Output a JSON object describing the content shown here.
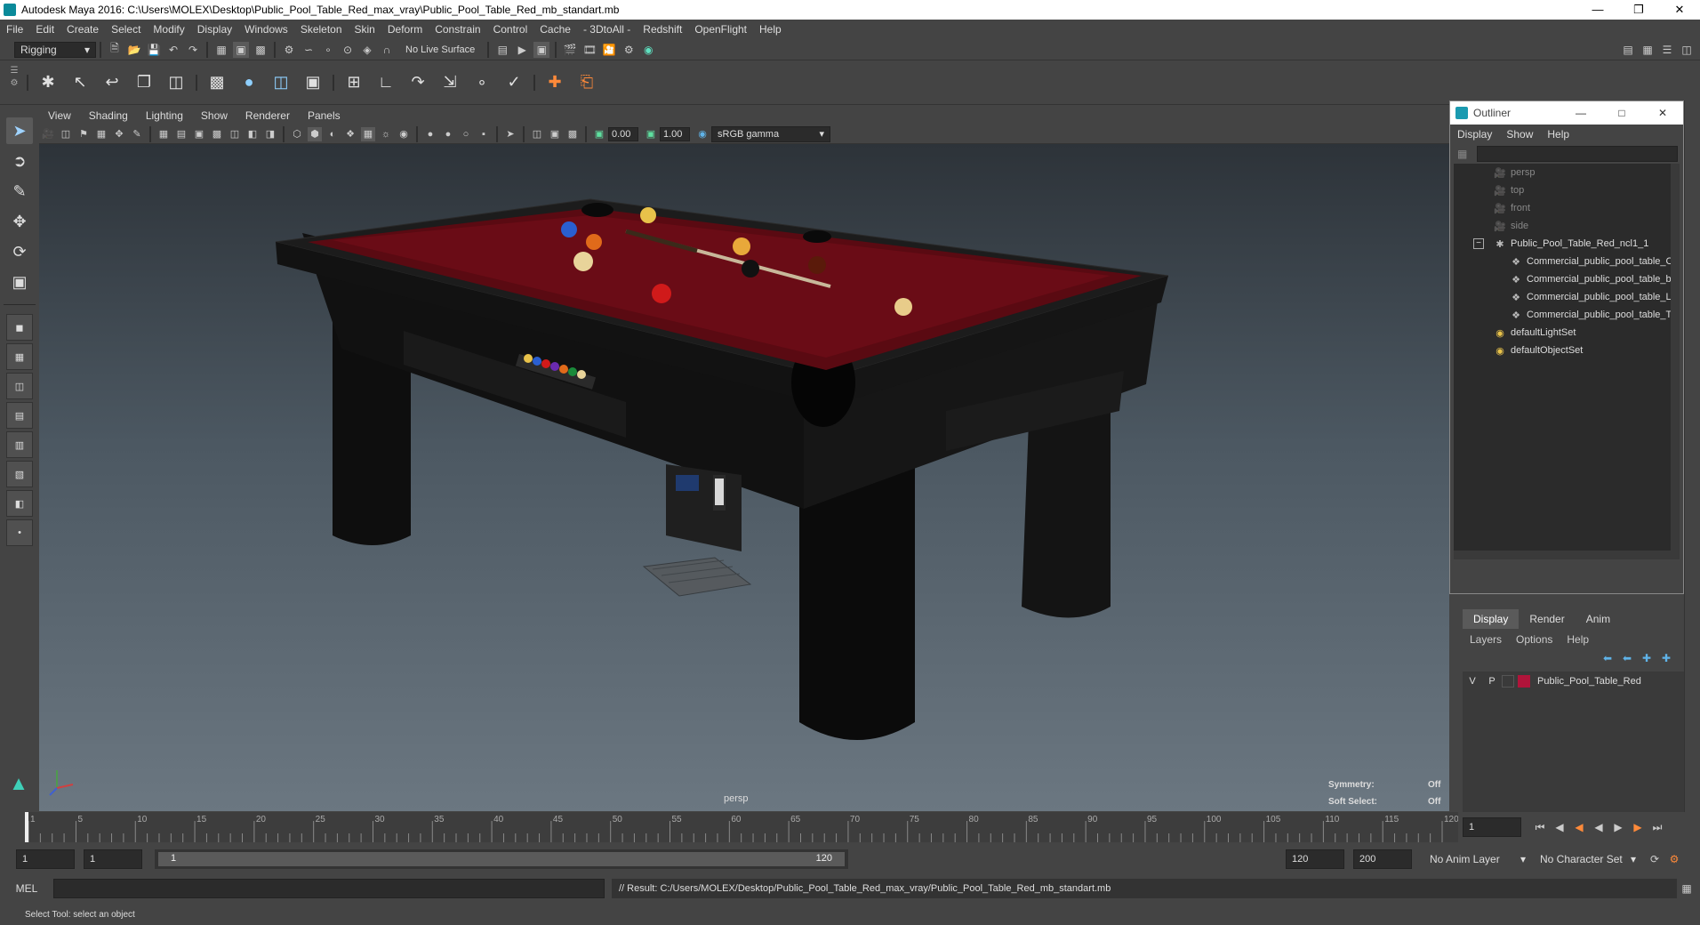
{
  "window": {
    "title": "Autodesk Maya 2016: C:\\Users\\MOLEX\\Desktop\\Public_Pool_Table_Red_max_vray\\Public_Pool_Table_Red_mb_standart.mb"
  },
  "menu": [
    "File",
    "Edit",
    "Create",
    "Select",
    "Modify",
    "Display",
    "Windows",
    "Skeleton",
    "Skin",
    "Deform",
    "Constrain",
    "Control",
    "Cache",
    "- 3DtoAll -",
    "Redshift",
    "OpenFlight",
    "Help"
  ],
  "status": {
    "mode": "Rigging",
    "live_surface": "No Live Surface"
  },
  "panel": {
    "menu": [
      "View",
      "Shading",
      "Lighting",
      "Show",
      "Renderer",
      "Panels"
    ],
    "exposure": "0.00",
    "gamma": "1.00",
    "colorspace": "sRGB gamma",
    "camera_label": "persp",
    "hud": {
      "symmetry_label": "Symmetry:",
      "symmetry_value": "Off",
      "soft_label": "Soft Select:",
      "soft_value": "Off"
    }
  },
  "outliner": {
    "title": "Outliner",
    "menu": [
      "Display",
      "Show",
      "Help"
    ],
    "items": [
      {
        "label": "persp",
        "icon": "camera-icon"
      },
      {
        "label": "top",
        "icon": "camera-icon"
      },
      {
        "label": "front",
        "icon": "camera-icon"
      },
      {
        "label": "side",
        "icon": "camera-icon"
      },
      {
        "label": "Public_Pool_Table_Red_ncl1_1",
        "icon": "group-icon"
      },
      {
        "label": "Commercial_public_pool_table_Cu",
        "icon": "mesh-icon"
      },
      {
        "label": "Commercial_public_pool_table_ba",
        "icon": "mesh-icon"
      },
      {
        "label": "Commercial_public_pool_table_Le",
        "icon": "mesh-icon"
      },
      {
        "label": "Commercial_public_pool_table_To",
        "icon": "mesh-icon"
      },
      {
        "label": "defaultLightSet",
        "icon": "set-icon"
      },
      {
        "label": "defaultObjectSet",
        "icon": "set-icon"
      }
    ]
  },
  "layers": {
    "tabs": [
      "Display",
      "Render",
      "Anim"
    ],
    "menu": [
      "Layers",
      "Options",
      "Help"
    ],
    "layer": {
      "v": "V",
      "p": "P",
      "name": "Public_Pool_Table_Red",
      "color": "#b0143a"
    }
  },
  "timeline": {
    "ticks": [
      "1",
      "5",
      "10",
      "15",
      "20",
      "25",
      "30",
      "35",
      "40",
      "45",
      "50",
      "55",
      "60",
      "65",
      "70",
      "75",
      "80",
      "85",
      "90",
      "95",
      "100",
      "105",
      "110",
      "115",
      "120"
    ],
    "current_frame": "1"
  },
  "range": {
    "start": "1",
    "anim_start": "1",
    "slider_start": "1",
    "slider_end": "120",
    "end": "120",
    "anim_end": "200",
    "anim_layer": "No Anim Layer",
    "char_set": "No Character Set"
  },
  "command": {
    "lang": "MEL",
    "result": "// Result: C:/Users/MOLEX/Desktop/Public_Pool_Table_Red_max_vray/Public_Pool_Table_Red_mb_standart.mb"
  },
  "help_line": "Select Tool: select an object",
  "accent": "#5fb3e8"
}
